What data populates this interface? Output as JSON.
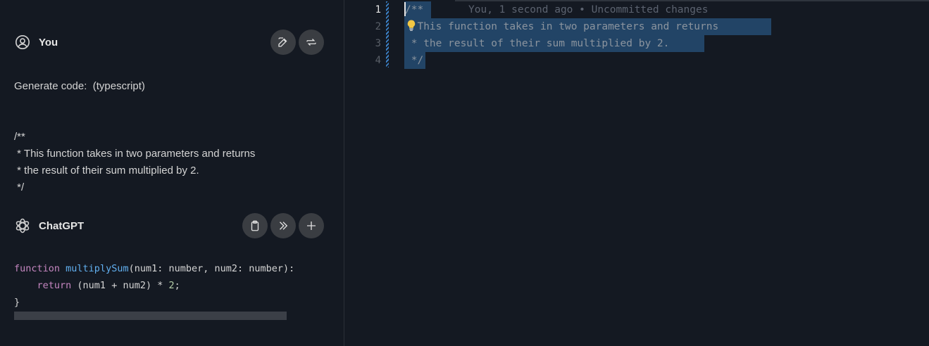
{
  "chat": {
    "user": {
      "name": "You",
      "lines": [
        "Generate code:  (typescript)",
        "",
        "",
        "/**",
        " * This function takes in two parameters and returns",
        " * the result of their sum multiplied by 2.",
        " */"
      ],
      "actions": [
        "edit-icon",
        "regenerate-icon"
      ]
    },
    "assistant": {
      "name": "ChatGPT",
      "actions": [
        "clipboard-icon",
        "insert-icon",
        "new-icon"
      ],
      "code": {
        "line1": {
          "kw": "function",
          "fn": "multiplySum",
          "rest": "(num1: number, num2: number): "
        },
        "line2": {
          "indent": "    ",
          "kw": "return",
          "rest": " (num1 + num2) * ",
          "num": "2",
          "end": ";"
        },
        "line3": "}"
      }
    }
  },
  "editor": {
    "line_numbers": [
      "1",
      "2",
      "3",
      "4"
    ],
    "active_line": 1,
    "lines": [
      "/**",
      "  This function takes in two parameters and returns",
      " * the result of their sum multiplied by 2.",
      " */"
    ],
    "blame": "You, 1 second ago • Uncommitted changes"
  },
  "colors": {
    "background": "#141922",
    "selection": "#264f78",
    "keyword": "#c586c0",
    "function": "#61afef",
    "number": "#b5cea8"
  }
}
